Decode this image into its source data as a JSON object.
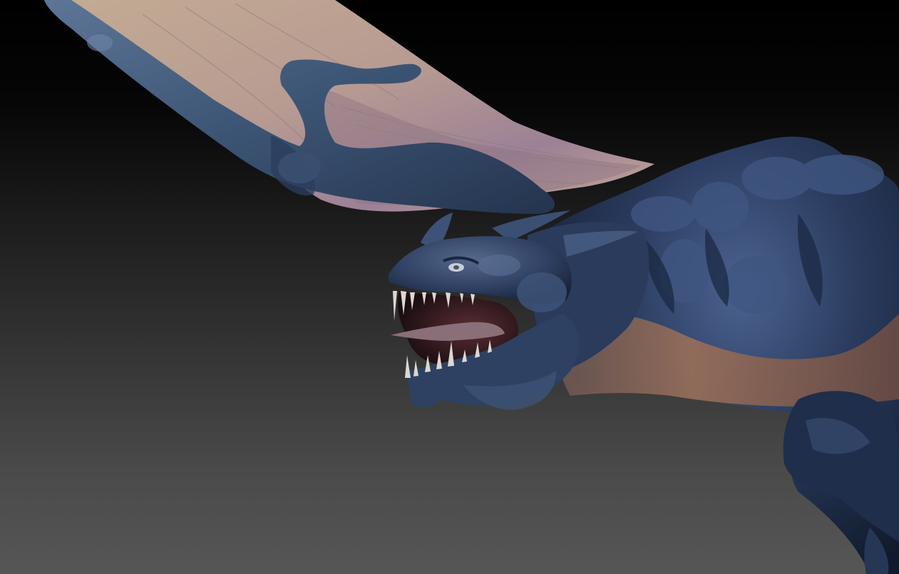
{
  "scene": {
    "subject": "dragon-sculpt",
    "colors": {
      "background_top": "#000000",
      "background_bottom": "#565656",
      "skin_blue": "#2b3f63",
      "skin_dark": "#162338",
      "skin_highlight": "#6d86ad",
      "wing_membrane": "#b39b8a",
      "wing_membrane_shadow": "#7d6b78",
      "belly": "#8a6450",
      "mouth_interior": "#3a2025",
      "teeth": "#dcd8cf",
      "eye": "#c9cdd4"
    }
  }
}
